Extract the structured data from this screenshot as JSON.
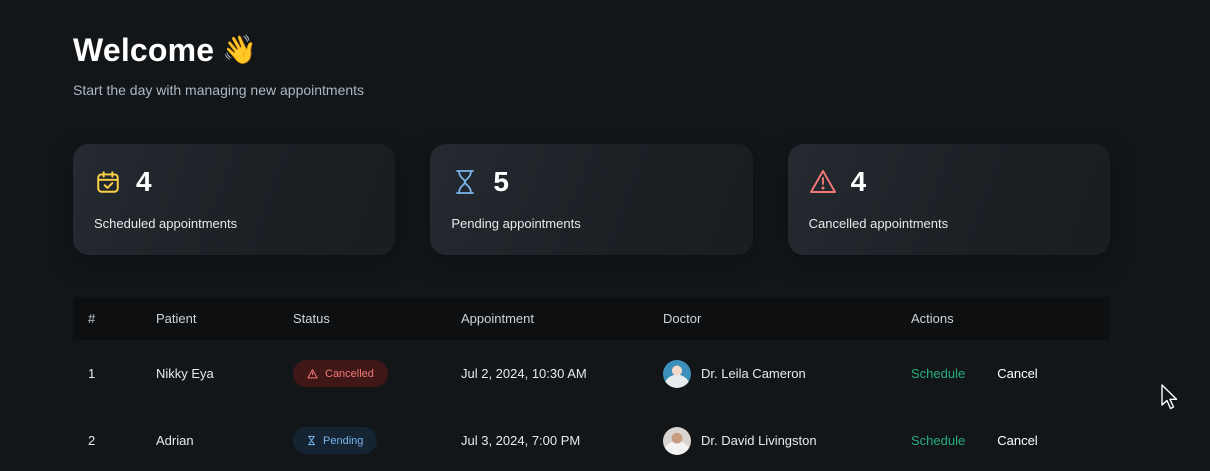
{
  "header": {
    "title": "Welcome",
    "title_emoji": "👋",
    "subtitle": "Start the day with managing new appointments"
  },
  "stats": [
    {
      "icon": "calendar-check-icon",
      "value": "4",
      "label": "Scheduled appointments",
      "color": "#FFD147"
    },
    {
      "icon": "hourglass-icon",
      "value": "5",
      "label": "Pending appointments",
      "color": "#79B5EC"
    },
    {
      "icon": "warning-triangle-icon",
      "value": "4",
      "label": "Cancelled appointments",
      "color": "#F37877"
    }
  ],
  "table": {
    "headers": [
      "#",
      "Patient",
      "Status",
      "Appointment",
      "Doctor",
      "Actions"
    ],
    "rows": [
      {
        "num": "1",
        "patient": "Nikky Eya",
        "status": "Cancelled",
        "status_icon": "warning-triangle-icon",
        "appointment": "Jul 2, 2024, 10:30 AM",
        "doctor": "Dr. Leila Cameron",
        "schedule": "Schedule",
        "cancel": "Cancel"
      },
      {
        "num": "2",
        "patient": "Adrian",
        "status": "Pending",
        "status_icon": "hourglass-icon",
        "appointment": "Jul 3, 2024, 7:00 PM",
        "doctor": "Dr. David Livingston",
        "schedule": "Schedule",
        "cancel": "Cancel"
      }
    ]
  },
  "colors": {
    "background": "#131619",
    "schedule_green": "#24AE7C",
    "cancelled_red": "#F37877",
    "pending_blue": "#79B5EC",
    "scheduled_yellow": "#FFD147"
  }
}
